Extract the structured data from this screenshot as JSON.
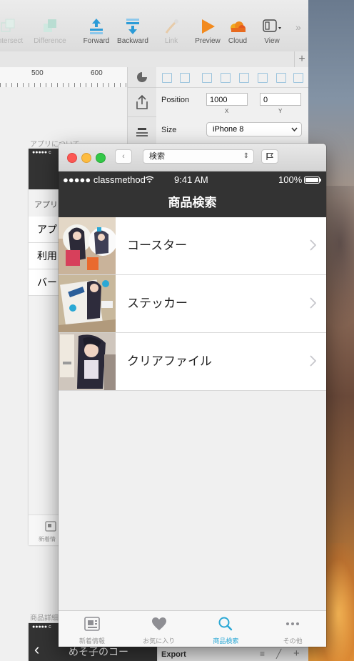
{
  "sketch": {
    "toolbar": [
      {
        "label": "Intersect",
        "icon": "intersect-icon",
        "enabled": false
      },
      {
        "label": "Difference",
        "icon": "difference-icon",
        "enabled": false
      },
      {
        "label": "Forward",
        "icon": "forward-icon",
        "enabled": true
      },
      {
        "label": "Backward",
        "icon": "backward-icon",
        "enabled": true
      },
      {
        "label": "Link",
        "icon": "link-icon",
        "enabled": false
      },
      {
        "label": "Preview",
        "icon": "preview-icon",
        "enabled": true
      },
      {
        "label": "Cloud",
        "icon": "cloud-icon",
        "enabled": true
      },
      {
        "label": "View",
        "icon": "view-icon",
        "enabled": true
      }
    ],
    "ruler_marks": [
      "500",
      "600"
    ],
    "inspector": {
      "position_label": "Position",
      "x_value": "1000",
      "y_value": "0",
      "x_label": "X",
      "y_label": "Y",
      "size_label": "Size",
      "size_value": "iPhone 8",
      "export_label": "Export"
    },
    "artboards": {
      "top_title": "アプリについて",
      "top_section": "アプリ",
      "top_items": [
        "アプ",
        "利用",
        "バー"
      ],
      "top_tab": "新着情",
      "bottom_title": "商品詳細",
      "bottom_nav": "めそ子のコー"
    }
  },
  "simulator": {
    "search_field": "検索",
    "status": {
      "carrier": "●●●●● classmethod",
      "time": "9:41 AM",
      "battery": "100%"
    },
    "nav_title": "商品検索",
    "items": [
      {
        "label": "コースター"
      },
      {
        "label": "ステッカー"
      },
      {
        "label": "クリアファイル"
      }
    ],
    "tabs": [
      {
        "label": "新着情報",
        "icon": "news-icon",
        "selected": false
      },
      {
        "label": "お気に入り",
        "icon": "heart-icon",
        "selected": false
      },
      {
        "label": "商品検索",
        "icon": "search-icon",
        "selected": true
      },
      {
        "label": "その他",
        "icon": "more-icon",
        "selected": false
      }
    ],
    "colors": {
      "accent": "#2aa8d5",
      "bar": "#333333"
    }
  }
}
